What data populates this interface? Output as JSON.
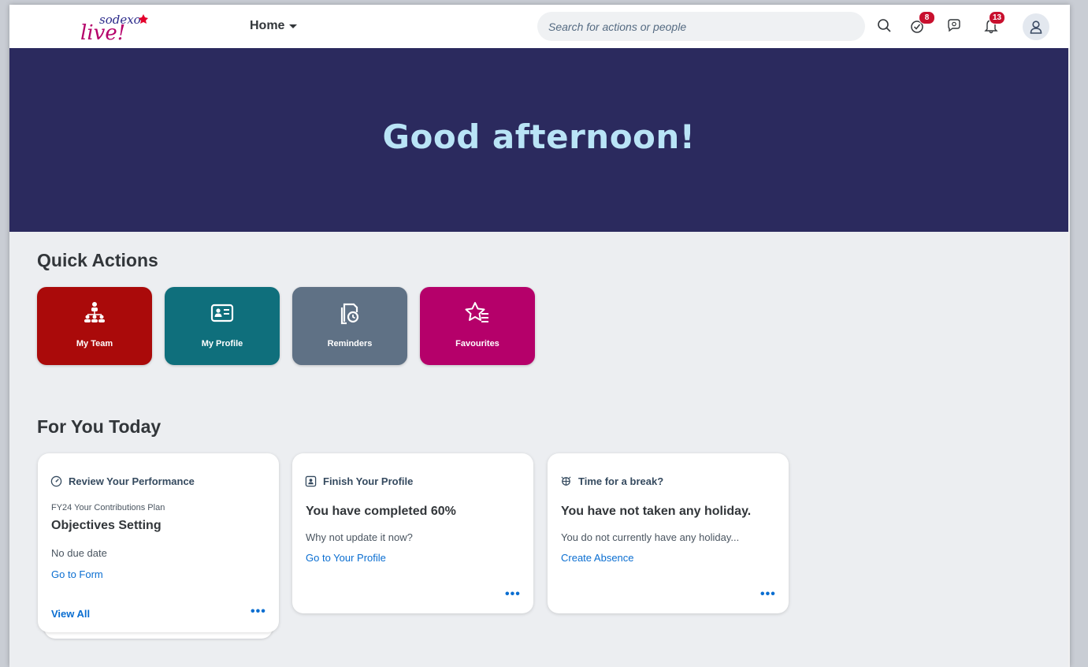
{
  "header": {
    "logo_text_top": "sodexo",
    "logo_text_bottom": "live!",
    "home_label": "Home",
    "search_placeholder": "Search for actions or people",
    "tasks_badge": "8",
    "notifications_badge": "13"
  },
  "hero": {
    "greeting": "Good afternoon!"
  },
  "quick_actions": {
    "title": "Quick Actions",
    "items": [
      {
        "label": "My Team",
        "color": "#aa0a0a",
        "icon": "team-icon"
      },
      {
        "label": "My Profile",
        "color": "#0f6f7c",
        "icon": "profile-card-icon"
      },
      {
        "label": "Reminders",
        "color": "#5f7185",
        "icon": "reminders-icon"
      },
      {
        "label": "Favourites",
        "color": "#b5006a",
        "icon": "favourites-icon"
      }
    ]
  },
  "for_you_today": {
    "title": "For You Today",
    "cards": [
      {
        "header": "Review Your Performance",
        "subtitle": "FY24 Your Contributions Plan",
        "title": "Objectives Setting",
        "detail": "No due date",
        "link": "Go to Form",
        "footer_link": "View All",
        "more": "•••"
      },
      {
        "header": "Finish Your Profile",
        "title": "You have completed 60%",
        "detail": "Why not update it now?",
        "link": "Go to Your Profile",
        "more": "•••"
      },
      {
        "header": "Time for a break?",
        "title": "You have not taken any holiday.",
        "detail": "You do not currently have any holiday...",
        "link": "Create Absence",
        "more": "•••"
      }
    ]
  }
}
